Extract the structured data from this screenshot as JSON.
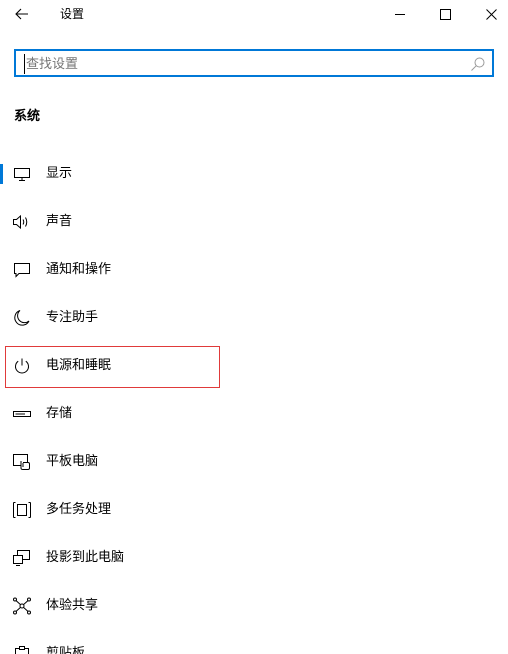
{
  "titlebar": {
    "title": "设置",
    "back_icon": "back-arrow-icon",
    "minimize_icon": "minimize-icon",
    "maximize_icon": "maximize-icon",
    "close_icon": "close-icon"
  },
  "search": {
    "placeholder": "查找设置",
    "value": "",
    "icon": "search-icon",
    "accent_color": "#0078d7"
  },
  "section": {
    "heading": "系统"
  },
  "nav": {
    "selected_index": 0,
    "highlighted_index": 4,
    "highlight_color": "#e03a3a",
    "items": [
      {
        "label": "显示",
        "icon": "monitor-icon"
      },
      {
        "label": "声音",
        "icon": "speaker-icon"
      },
      {
        "label": "通知和操作",
        "icon": "notification-icon"
      },
      {
        "label": "专注助手",
        "icon": "moon-icon"
      },
      {
        "label": "电源和睡眠",
        "icon": "power-icon"
      },
      {
        "label": "存储",
        "icon": "storage-icon"
      },
      {
        "label": "平板电脑",
        "icon": "tablet-icon"
      },
      {
        "label": "多任务处理",
        "icon": "multitasking-icon"
      },
      {
        "label": "投影到此电脑",
        "icon": "project-icon"
      },
      {
        "label": "体验共享",
        "icon": "share-icon"
      },
      {
        "label": "剪贴板",
        "icon": "clipboard-icon"
      }
    ]
  }
}
